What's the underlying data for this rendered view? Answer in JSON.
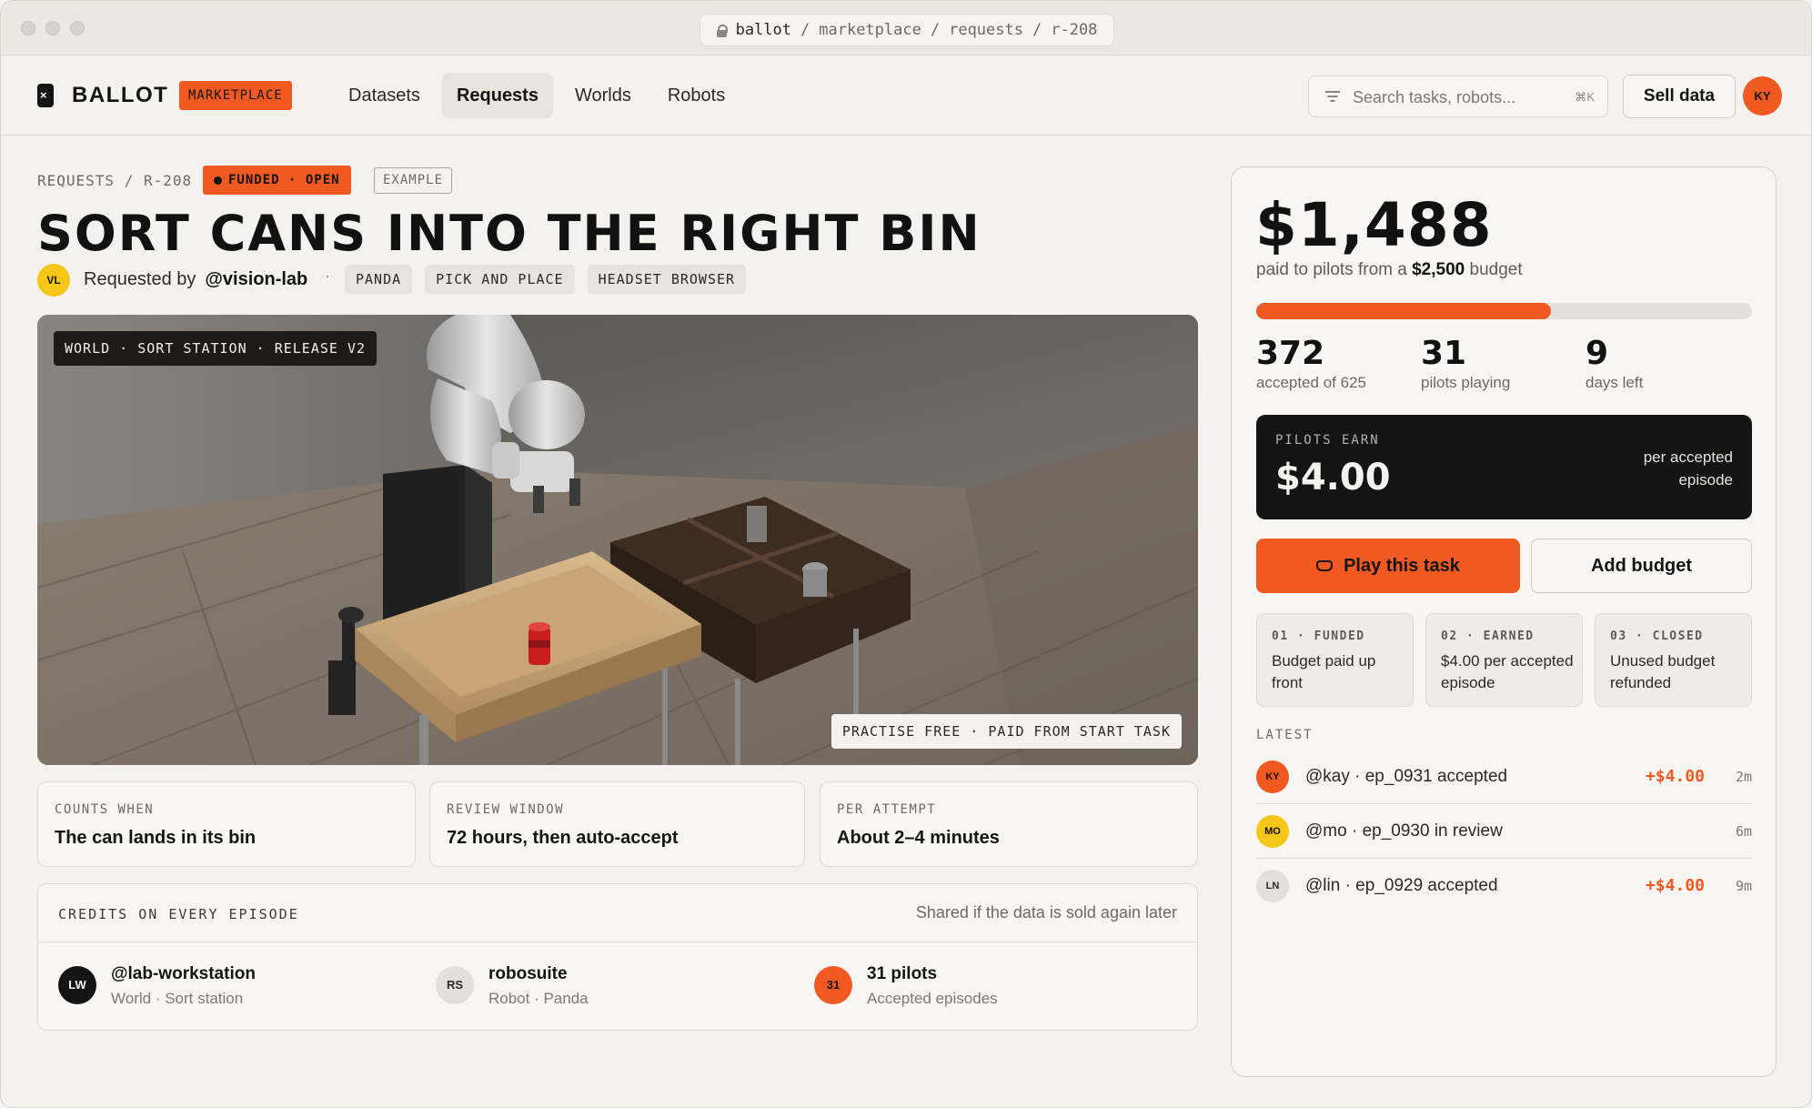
{
  "browser": {
    "url_parts": [
      "ballot",
      "/",
      "marketplace",
      "/",
      "requests",
      "/",
      "r-208"
    ]
  },
  "nav": {
    "brand": "BALLOT",
    "badge": "MARKETPLACE",
    "links": [
      "Datasets",
      "Requests",
      "Worlds",
      "Robots"
    ],
    "active_link": "Requests",
    "search_placeholder": "Search tasks, robots...",
    "search_shortcut": "⌘K",
    "sell_label": "Sell data",
    "user_initials": "KY"
  },
  "request": {
    "breadcrumb": "REQUESTS / R-208",
    "status": "FUNDED · OPEN",
    "example": "EXAMPLE",
    "title": "SORT CANS INTO THE RIGHT BIN",
    "requester_initials": "VL",
    "requested_by_label": "Requested by",
    "requester": "@vision-lab",
    "separator": "·",
    "tags": [
      "PANDA",
      "PICK AND PLACE",
      "HEADSET BROWSER"
    ],
    "scene_label": "WORLD · SORT STATION · RELEASE V2",
    "scene_note": "PRACTISE FREE · PAID FROM START TASK"
  },
  "info_cards": [
    {
      "key": "COUNTS WHEN",
      "value": "The can lands in its bin"
    },
    {
      "key": "REVIEW WINDOW",
      "value": "72 hours, then auto-accept"
    },
    {
      "key": "PER ATTEMPT",
      "value": "About 2–4 minutes"
    }
  ],
  "credits": {
    "title": "CREDITS ON EVERY EPISODE",
    "note": "Shared if the data is sold again later",
    "items": [
      {
        "initials": "LW",
        "name": "@lab-workstation",
        "sub": "World · Sort station"
      },
      {
        "initials": "RS",
        "name": "robosuite",
        "sub": "Robot · Panda"
      },
      {
        "initials": "31",
        "name": "31 pilots",
        "sub": "Accepted episodes"
      }
    ]
  },
  "panel": {
    "paid_amount": "$1,488",
    "paid_prefix": "paid to pilots from a",
    "budget": "$2,500",
    "paid_suffix": "budget",
    "progress_fraction": 0.595,
    "stats": [
      {
        "value": "372",
        "label": "accepted of 625"
      },
      {
        "value": "31",
        "label": "pilots playing"
      },
      {
        "value": "9",
        "label": "days left"
      }
    ],
    "earn_label": "PILOTS EARN",
    "earn_value": "$4.00",
    "earn_unit": "per accepted episode",
    "play_label": "Play this task",
    "add_budget_label": "Add budget",
    "steps": [
      {
        "key": "01 · FUNDED",
        "text": "Budget paid up front"
      },
      {
        "key": "02 · EARNED",
        "text": "$4.00 per accepted episode"
      },
      {
        "key": "03 · CLOSED",
        "text": "Unused budget refunded"
      }
    ],
    "latest_label": "LATEST",
    "activity": [
      {
        "initials": "KY",
        "text": "@kay · ep_0931 accepted",
        "amount": "+$4.00",
        "time": "2m",
        "color": "#f05a22"
      },
      {
        "initials": "MO",
        "text": "@mo · ep_0930 in review",
        "amount": "",
        "time": "6m",
        "color": "#f5c518"
      },
      {
        "initials": "LN",
        "text": "@lin · ep_0929 accepted",
        "amount": "+$4.00",
        "time": "9m",
        "color": "#e4e0d9"
      }
    ]
  },
  "colors": {
    "accent": "#f05a22",
    "yellow": "#f5c518",
    "dark": "#141414",
    "background": "#f4f2ee"
  }
}
